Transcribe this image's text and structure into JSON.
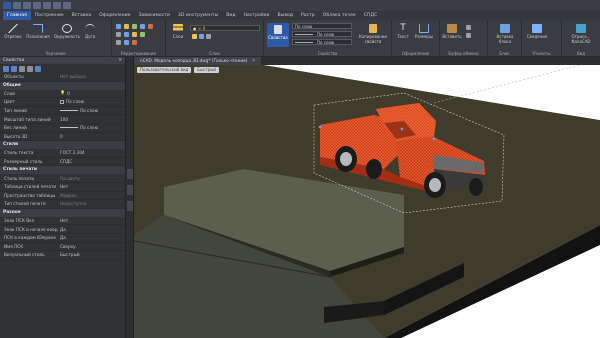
{
  "menu_tabs": [
    "Главная",
    "Построение",
    "Вставка",
    "Оформление",
    "Зависимости",
    "3D инструменты",
    "Вид",
    "Настройки",
    "Вывод",
    "Растр",
    "Облака точек",
    "СПДС"
  ],
  "active_tab": "Главная",
  "ribbon": {
    "groups": {
      "drawing": "Черчение",
      "editing": "Редактирование",
      "layers": "Слои",
      "properties": "Свойства",
      "clipboard": "Буфер обмена",
      "block": "Блок",
      "utilities": "Утилиты",
      "view": "Вид"
    },
    "buttons": {
      "segment": "Отрезок",
      "polyline": "Полилиния",
      "circle": "Окружность",
      "arc": "Дуга",
      "layers": "Слои",
      "properties": "Свойства",
      "copy_props": "Копирование свойств",
      "text": "Текст",
      "dims": "Размеры",
      "paste": "Вставить",
      "insert_block": "Вставка блока",
      "info": "Сведения",
      "hint": "Отрисо... NanoCAD"
    },
    "props_values": {
      "color": "По слою",
      "linetype": "По слою",
      "lineweight": "По слою"
    }
  },
  "properties_panel": {
    "title": "Свойства",
    "objects_label": "Объекты",
    "objects_value": "Нет выбора",
    "sections": [
      {
        "name": "Общие",
        "rows": [
          {
            "k": "Слой",
            "v": "0",
            "dim": false,
            "type": "layer"
          },
          {
            "k": "Цвет",
            "v": "По слою",
            "dim": false,
            "type": "color"
          },
          {
            "k": "Тип линий",
            "v": "По слою",
            "dim": false,
            "type": "line"
          },
          {
            "k": "Масштаб типа линий",
            "v": "100",
            "dim": false,
            "type": "text"
          },
          {
            "k": "Вес линий",
            "v": "По слою",
            "dim": false,
            "type": "line"
          },
          {
            "k": "Высота 3D",
            "v": "0",
            "dim": false,
            "type": "text"
          }
        ]
      },
      {
        "name": "Стили",
        "rows": [
          {
            "k": "Стиль текста",
            "v": "ГОСТ 2.304",
            "dim": false,
            "type": "text"
          },
          {
            "k": "Размерный стиль",
            "v": "СПДС",
            "dim": false,
            "type": "text"
          }
        ]
      },
      {
        "name": "Стиль печати",
        "rows": [
          {
            "k": "Стиль печати",
            "v": "По цвету",
            "dim": true,
            "type": "text"
          },
          {
            "k": "Таблица стилей печати",
            "v": "Нет",
            "dim": false,
            "type": "text"
          },
          {
            "k": "Пространство таблицы ...",
            "v": "Модель",
            "dim": true,
            "type": "text"
          },
          {
            "k": "Тип стилей печати",
            "v": "Недоступно",
            "dim": true,
            "type": "text"
          }
        ]
      },
      {
        "name": "Разное",
        "rows": [
          {
            "k": "Знак ПСК Вкл",
            "v": "Нет",
            "dim": false,
            "type": "text"
          },
          {
            "k": "Знак ПСК в начале коорд...",
            "v": "Да",
            "dim": false,
            "type": "text"
          },
          {
            "k": "ПСК в каждом ВЭкране",
            "v": "Да",
            "dim": false,
            "type": "text"
          },
          {
            "k": "Имя ПСК",
            "v": "Сверху",
            "dim": false,
            "type": "text"
          },
          {
            "k": "Визуальный стиль",
            "v": "Быстрый",
            "dim": false,
            "type": "text"
          }
        ]
      }
    ]
  },
  "document": {
    "tab_title": "nCAD. Модель колодца 3D.dwg* (Только чтение)",
    "viewport_tabs": [
      "Пользовательский вид",
      "Быстрый"
    ]
  },
  "colors": {
    "accent": "#2f5aa8",
    "ground": "#3d3a2a",
    "truck": "#d8421b"
  }
}
